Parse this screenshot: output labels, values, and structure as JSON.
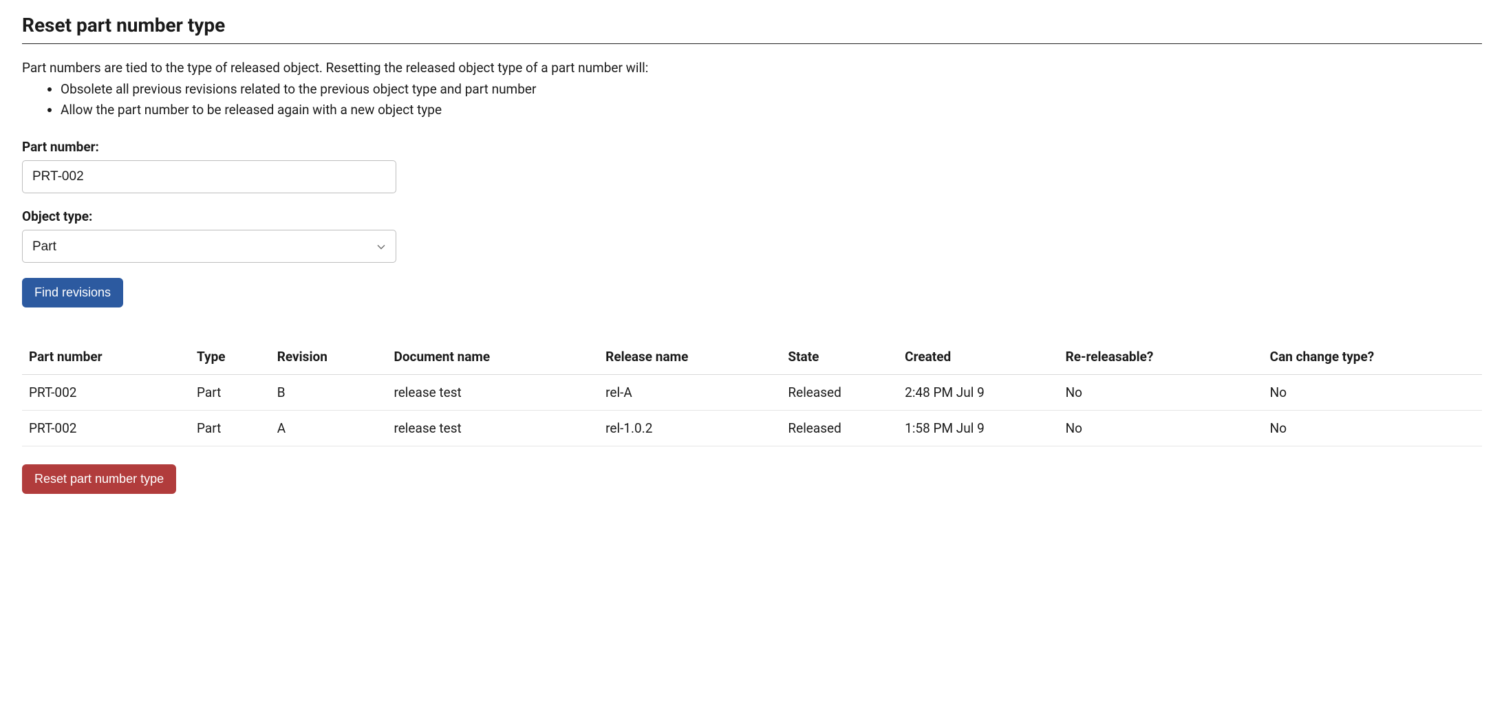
{
  "title": "Reset part number type",
  "description": {
    "intro": "Part numbers are tied to the type of released object. Resetting the released object type of a part number will:",
    "bullets": [
      "Obsolete all previous revisions related to the previous object type and part number",
      "Allow the part number to be released again with a new object type"
    ]
  },
  "form": {
    "part_number_label": "Part number:",
    "part_number_value": "PRT-002",
    "object_type_label": "Object type:",
    "object_type_value": "Part",
    "find_button": "Find revisions"
  },
  "table": {
    "headers": {
      "part_number": "Part number",
      "type": "Type",
      "revision": "Revision",
      "document_name": "Document name",
      "release_name": "Release name",
      "state": "State",
      "created": "Created",
      "re_releasable": "Re-releasable?",
      "can_change_type": "Can change type?"
    },
    "rows": [
      {
        "part_number": "PRT-002",
        "type": "Part",
        "revision": "B",
        "document_name": "release test",
        "release_name": "rel-A",
        "state": "Released",
        "created": "2:48 PM Jul 9",
        "re_releasable": "No",
        "can_change_type": "No"
      },
      {
        "part_number": "PRT-002",
        "type": "Part",
        "revision": "A",
        "document_name": "release test",
        "release_name": "rel-1.0.2",
        "state": "Released",
        "created": "1:58 PM Jul 9",
        "re_releasable": "No",
        "can_change_type": "No"
      }
    ]
  },
  "reset_button": "Reset part number type"
}
